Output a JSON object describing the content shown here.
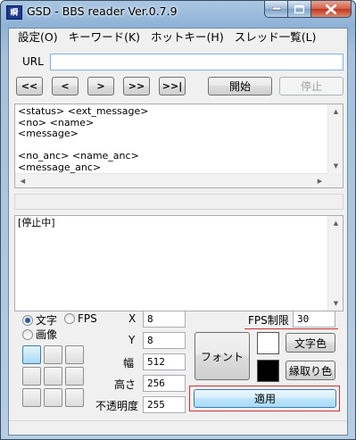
{
  "window": {
    "title": "GSD - BBS reader Ver.0.7.9",
    "icon_text": "瞬"
  },
  "menu": [
    "設定(O)",
    "キーワード(K)",
    "ホットキー(H)",
    "スレッド一覧(L)"
  ],
  "url": {
    "label": "URL",
    "value": ""
  },
  "nav_buttons": [
    "<<",
    "<",
    ">",
    ">>",
    ">>|"
  ],
  "start_button": "開始",
  "stop_button": "停止",
  "template_lines": [
    "<status> <ext_message>",
    "<no> <name>",
    "<message>",
    "",
    "<no_anc> <name_anc>",
    "<message_anc>"
  ],
  "log_text": "[停止中]",
  "mode": {
    "text_label": "文字",
    "fps_label": "FPS",
    "image_label": "画像",
    "selected": "文字"
  },
  "fields": {
    "x_label": "X",
    "x_value": "8",
    "y_label": "Y",
    "y_value": "8",
    "width_label": "幅",
    "width_value": "512",
    "height_label": "高さ",
    "height_value": "256",
    "opacity_label": "不透明度",
    "opacity_value": "255",
    "fps_label": "FPS制限",
    "fps_value": "30"
  },
  "font_button": "フォント",
  "text_color_button": "文字色",
  "outline_color_button": "縁取り色",
  "apply_button": "適用",
  "colors": {
    "text_color": "#ffffff",
    "outline_color": "#000000",
    "highlight": "#d03030"
  }
}
